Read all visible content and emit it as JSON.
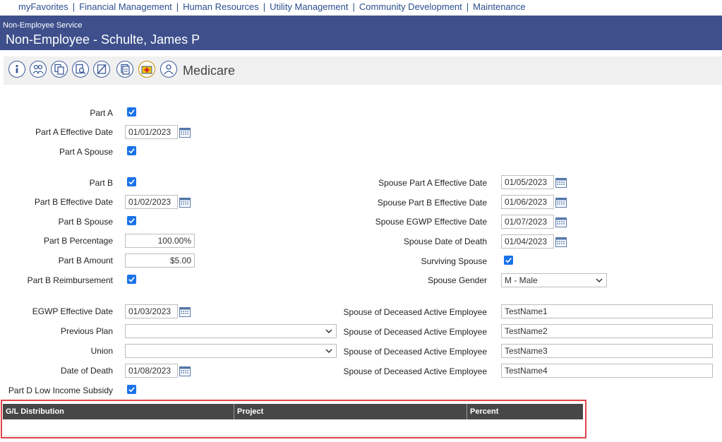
{
  "topnav": {
    "items": [
      "myFavorites",
      "Financial Management",
      "Human Resources",
      "Utility Management",
      "Community Development",
      "Maintenance"
    ]
  },
  "header": {
    "service": "Non-Employee Service",
    "title": "Non-Employee - Schulte, James P"
  },
  "toolbar": {
    "icons": [
      "info-icon",
      "people-icon",
      "copy-icon",
      "search-document-icon",
      "no-entry-icon",
      "documents-icon",
      "medical-icon",
      "person-icon"
    ],
    "title": "Medicare"
  },
  "form": {
    "part_a": {
      "label": "Part A",
      "checked": true
    },
    "part_a_effective_date": {
      "label": "Part A Effective Date",
      "value": "01/01/2023"
    },
    "part_a_spouse": {
      "label": "Part A Spouse",
      "checked": true
    },
    "part_b": {
      "label": "Part B",
      "checked": true
    },
    "part_b_effective_date": {
      "label": "Part B Effective Date",
      "value": "01/02/2023"
    },
    "part_b_spouse": {
      "label": "Part B Spouse",
      "checked": true
    },
    "part_b_percentage": {
      "label": "Part B Percentage",
      "value": "100.00%"
    },
    "part_b_amount": {
      "label": "Part B Amount",
      "value": "$5.00"
    },
    "part_b_reimbursement": {
      "label": "Part B Reimbursement",
      "checked": true
    },
    "egwp_effective_date": {
      "label": "EGWP Effective Date",
      "value": "01/03/2023"
    },
    "previous_plan": {
      "label": "Previous Plan",
      "value": ""
    },
    "union": {
      "label": "Union",
      "value": ""
    },
    "date_of_death": {
      "label": "Date of Death",
      "value": "01/08/2023"
    },
    "part_d_low_income_subsidy": {
      "label": "Part D Low Income Subsidy",
      "checked": true
    },
    "spouse_part_a_effective_date": {
      "label": "Spouse Part A Effective Date",
      "value": "01/05/2023"
    },
    "spouse_part_b_effective_date": {
      "label": "Spouse Part B Effective Date",
      "value": "01/06/2023"
    },
    "spouse_egwp_effective_date": {
      "label": "Spouse EGWP Effective Date",
      "value": "01/07/2023"
    },
    "spouse_date_of_death": {
      "label": "Spouse Date of Death",
      "value": "01/04/2023"
    },
    "surviving_spouse": {
      "label": "Surviving Spouse",
      "checked": true
    },
    "spouse_gender": {
      "label": "Spouse Gender",
      "value": "M - Male"
    },
    "spouse_of_deceased": [
      {
        "label": "Spouse of Deceased Active Employee",
        "value": "TestName1"
      },
      {
        "label": "Spouse of Deceased Active Employee",
        "value": "TestName2"
      },
      {
        "label": "Spouse of Deceased Active Employee",
        "value": "TestName3"
      },
      {
        "label": "Spouse of Deceased Active Employee",
        "value": "TestName4"
      }
    ]
  },
  "gl_table": {
    "columns": [
      "G/L Distribution",
      "Project",
      "Percent"
    ]
  },
  "colors": {
    "header_bg": "#3e4f8c",
    "nav_link": "#2a4f8f",
    "checkbox": "#1a73e8",
    "highlight_border": "#e0444c",
    "table_header": "#474747"
  }
}
